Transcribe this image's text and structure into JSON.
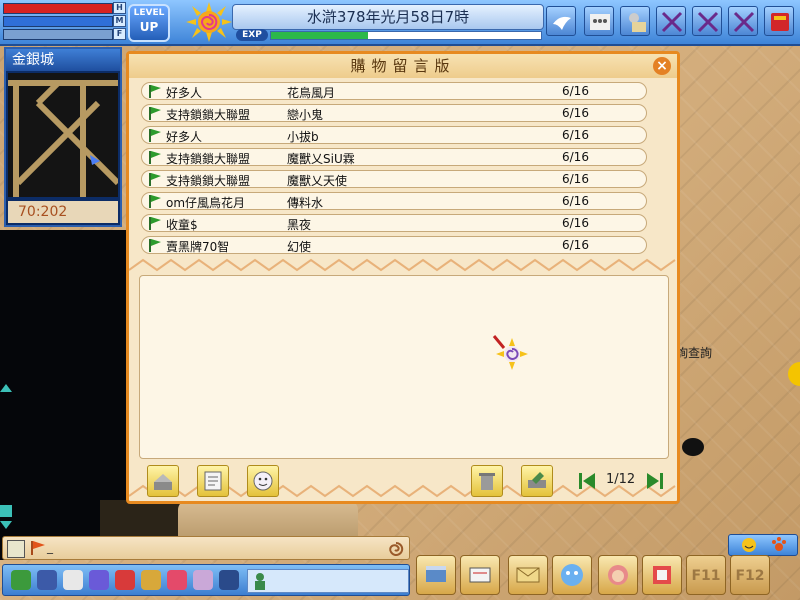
{
  "hud": {
    "bar_tags": [
      "H",
      "M",
      "F"
    ],
    "bar_colors": [
      "#d62222",
      "#2f6fd8",
      "#7aa0d0"
    ],
    "level_up_line1": "LEVEL",
    "level_up_line2": "UP",
    "date": "水滸378年光月58日7時",
    "exp_label": "EXP",
    "top_buttons": [
      "mail-bird-icon",
      "team-icon",
      "trade-icon",
      "cross-icon",
      "cross-icon",
      "cross-icon",
      "book-icon"
    ]
  },
  "minimap": {
    "map_name": "金銀城",
    "coords": "70:202"
  },
  "board": {
    "title": "購物留言版",
    "close_label": "×",
    "rows": [
      {
        "author": "好多人",
        "seller": "花鳥風月",
        "date": "6/16"
      },
      {
        "author": "支持鎖鎖大聯盟",
        "seller": "戀小鬼",
        "date": "6/16"
      },
      {
        "author": "好多人",
        "seller": "小拔b",
        "date": "6/16"
      },
      {
        "author": "支持鎖鎖大聯盟",
        "seller": "魔獸乂SiU霖",
        "date": "6/16"
      },
      {
        "author": "支持鎖鎖大聯盟",
        "seller": "魔獸乂天使",
        "date": "6/16"
      },
      {
        "author": "om仔風鳥花月",
        "seller": "傳料水",
        "date": "6/16"
      },
      {
        "author": "收童$",
        "seller": "黑夜",
        "date": "6/16"
      },
      {
        "author": "賣黑牌70智",
        "seller": "幻使",
        "date": "6/16"
      }
    ],
    "page": "1/12"
  },
  "world": {
    "npc_label": "詢查詢"
  },
  "bottom": {
    "chat_text": "_",
    "fkeys": [
      "F11",
      "F12"
    ]
  }
}
